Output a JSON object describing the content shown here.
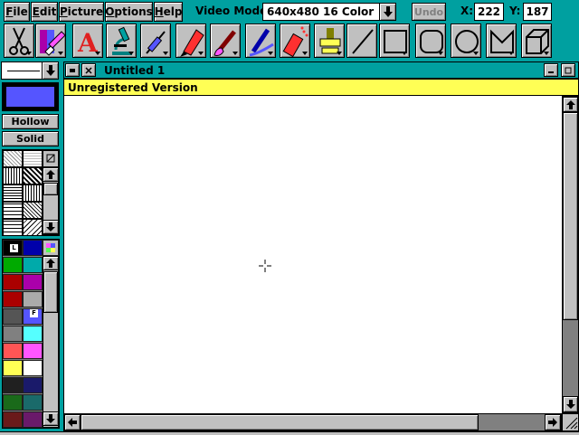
{
  "menu": {
    "file": {
      "ul": "F",
      "rest": "ile"
    },
    "edit": {
      "ul": "E",
      "rest": "dit"
    },
    "picture": {
      "ul": "P",
      "rest": "icture"
    },
    "options": {
      "ul": "O",
      "rest": "ptions"
    },
    "help": {
      "ul": "H",
      "rest": "elp"
    }
  },
  "toolbar_top": {
    "video_mode_label": "Video Mode:",
    "video_mode_value": "640x480 16 Color",
    "undo_label": "Undo",
    "x_label": "X:",
    "x_value": "222",
    "y_label": "Y:",
    "y_value": "187"
  },
  "tools": [
    "scissors-icon",
    "eraser-icon",
    "text-icon",
    "microscope-icon",
    "syringe-icon",
    "marker-icon",
    "brush-icon",
    "roller-icon",
    "spraycan-icon",
    "stamp-icon",
    "line-icon",
    "rectangle-icon",
    "rounded-rectangle-icon",
    "ellipse-icon",
    "polygon-icon",
    "cube-icon"
  ],
  "left_panel": {
    "current_color": "#5555ff",
    "hollow_label": "Hollow",
    "solid_label": "Solid",
    "left_color_marker": "L",
    "fill_color_marker": "F"
  },
  "palette": [
    [
      "#000000",
      "#0000aa"
    ],
    [
      "#00aa00",
      "#00aaaa"
    ],
    [
      "#aa0000",
      "#aa00aa"
    ],
    [
      "#aa0000",
      "#aaaaaa"
    ],
    [
      "#555555",
      "#5555ff"
    ],
    [
      "#808080",
      "#55ffff"
    ],
    [
      "#ff5555",
      "#ff55ff"
    ],
    [
      "#ffff55",
      "#ffffff"
    ],
    [
      "#202020",
      "#1a1a6a"
    ],
    [
      "#1a6a1a",
      "#1a6a6a"
    ],
    [
      "#6a1a1a",
      "#6a1a6a"
    ]
  ],
  "document": {
    "title": "Untitled 1",
    "banner": "Unregistered Version"
  }
}
